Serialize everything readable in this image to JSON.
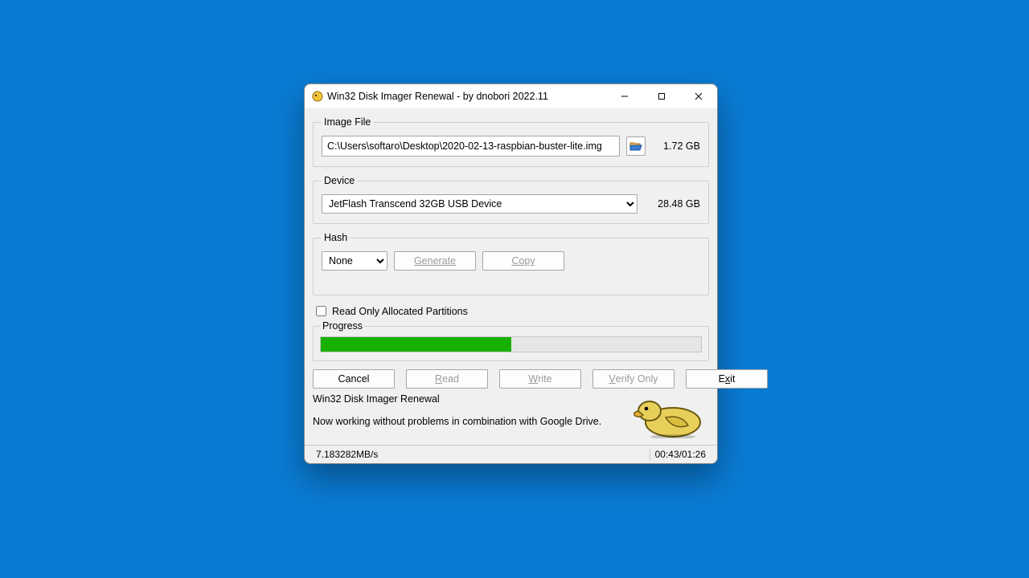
{
  "title": "Win32 Disk Imager Renewal - by dnobori 2022.11",
  "imageFile": {
    "label": "Image File",
    "path": "C:\\Users\\softaro\\Desktop\\2020-02-13-raspbian-buster-lite.img",
    "size": "1.72 GB"
  },
  "device": {
    "label": "Device",
    "value": "JetFlash Transcend 32GB USB Device",
    "size": "28.48 GB"
  },
  "hash": {
    "label": "Hash",
    "algo": "None",
    "generate": "Generate",
    "copy": "Copy"
  },
  "readOnly": {
    "label": "Read Only Allocated Partitions",
    "checked": false
  },
  "progress": {
    "label": "Progress",
    "percent": 50
  },
  "actions": {
    "cancel": "Cancel",
    "read_pre": "",
    "read_u": "R",
    "read_post": "ead",
    "write_pre": "",
    "write_u": "W",
    "write_post": "rite",
    "verify_pre": "",
    "verify_u": "V",
    "verify_post": "erify Only",
    "exit_pre": "E",
    "exit_u": "x",
    "exit_post": "it"
  },
  "footer": {
    "appname": "Win32 Disk Imager Renewal",
    "tagline": "Now working without problems in combination with Google Drive."
  },
  "status": {
    "speed": "7.183282MB/s",
    "time": "00:43/01:26"
  }
}
